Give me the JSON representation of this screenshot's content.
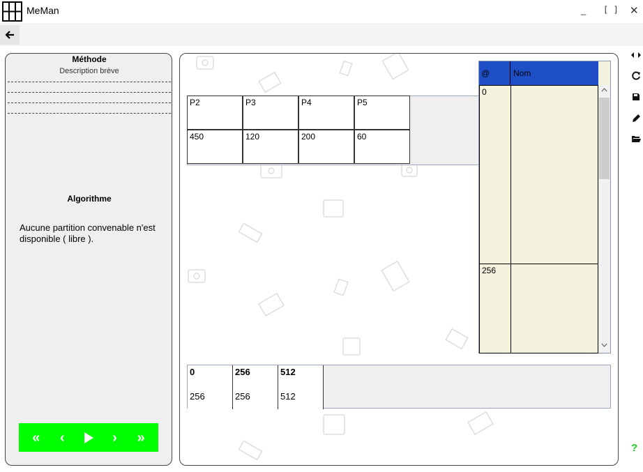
{
  "app": {
    "title": "MeMan"
  },
  "window": {
    "minimize": "_",
    "maximize": "[ ]",
    "close": "✕"
  },
  "nav": {
    "back_icon": "arrow-left-icon"
  },
  "left": {
    "method_title": "Méthode",
    "method_desc": "Description brève",
    "algo_title": "Algorithme",
    "algo_message": "Aucune partition convenable n'est disponible ( libre )."
  },
  "controls": {
    "first": "«",
    "prev": "‹",
    "next": "›",
    "last": "»",
    "play_icon": "play-icon",
    "accent": "#00ff00"
  },
  "partitions": {
    "names": [
      "P2",
      "P3",
      "P4",
      "P5"
    ],
    "sizes": [
      "450",
      "120",
      "200",
      "60"
    ]
  },
  "memory": {
    "headers": {
      "address": "@",
      "name": "Nom"
    },
    "header_color": "#1e4fc7",
    "rows": [
      {
        "address": "0",
        "name": ""
      },
      {
        "address": "256",
        "name": ""
      }
    ]
  },
  "addresses": {
    "cells": [
      {
        "top": "0",
        "bottom": "256"
      },
      {
        "top": "256",
        "bottom": "256"
      },
      {
        "top": "512",
        "bottom": "512"
      }
    ]
  },
  "toolbar": {
    "icons": [
      "arrows-icon",
      "refresh-icon",
      "save-icon",
      "edit-icon",
      "folder-open-icon",
      "help-icon"
    ],
    "help": "?"
  }
}
